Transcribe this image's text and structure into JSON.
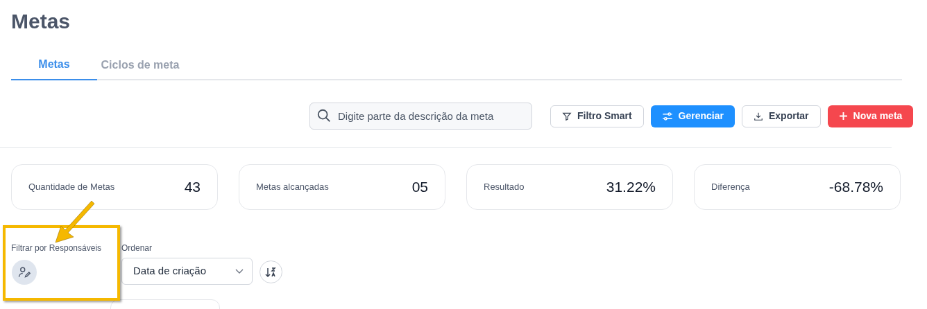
{
  "page_title": "Metas",
  "tabs": [
    {
      "label": "Metas",
      "selected": true
    },
    {
      "label": "Ciclos de meta",
      "selected": false
    }
  ],
  "search": {
    "placeholder": "Digite parte da descrição da meta"
  },
  "toolbar_buttons": [
    {
      "label": "Filtro Smart",
      "kind": "filter"
    },
    {
      "label": "Gerenciar",
      "kind": "manage"
    },
    {
      "label": "Exportar",
      "kind": "export"
    },
    {
      "label": "Nova meta",
      "kind": "new"
    }
  ],
  "stats": [
    {
      "label": "Quantidade de Metas",
      "value": "43"
    },
    {
      "label": "Metas alcançadas",
      "value": "05"
    },
    {
      "label": "Resultado",
      "value": "31.22%"
    },
    {
      "label": "Diferença",
      "value": "-68.78%"
    }
  ],
  "filter": {
    "label": "Filtrar por Responsáveis"
  },
  "sort": {
    "label": "Ordenar",
    "value": "Data de criação"
  }
}
